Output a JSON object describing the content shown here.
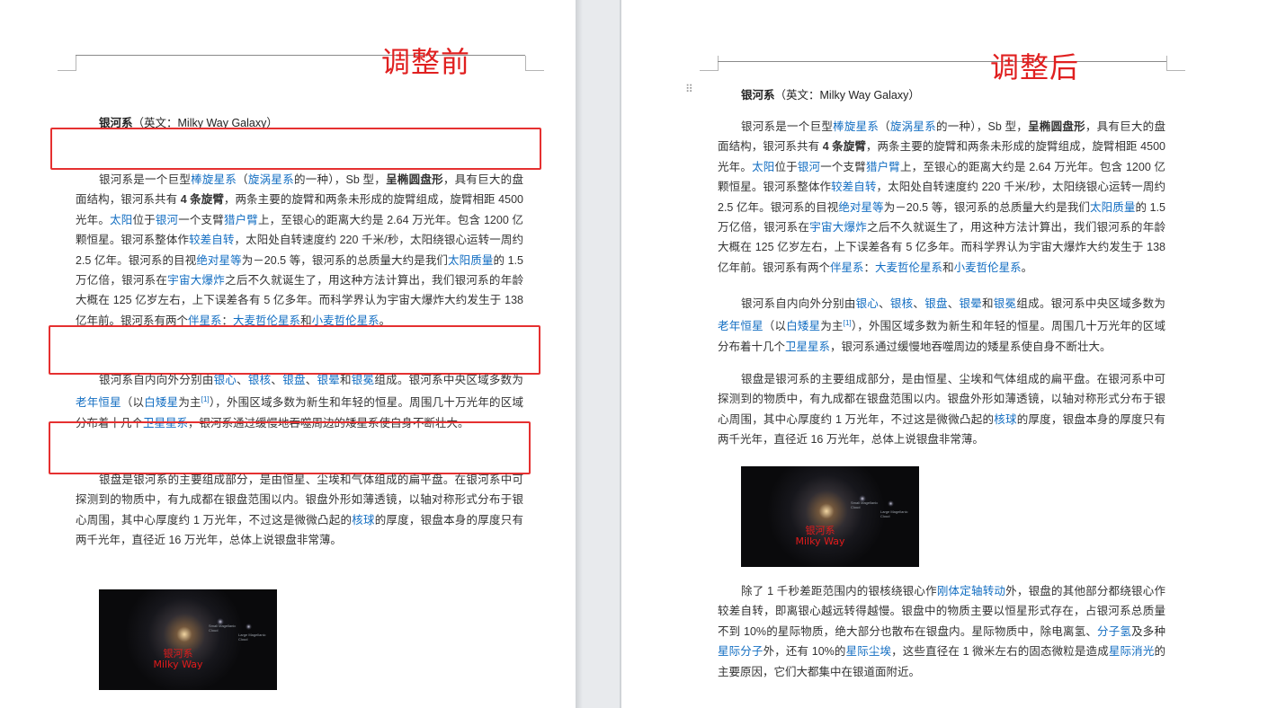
{
  "left": {
    "label": "调整前",
    "title_bold": "银河系",
    "title_rest": "（英文：Milky Way Galaxy）",
    "p1": [
      "银河系是一个巨型",
      {
        "link": "棒旋星系"
      },
      "（",
      {
        "link": "旋涡星系"
      },
      "的一种），Sb 型，",
      {
        "bold": "呈椭圆盘形"
      },
      "，具有巨大的盘面结构，银河系共有 ",
      {
        "bold": "4 条旋臂"
      },
      "，两条主要的旋臂和两条未形成的旋臂组成，旋臂相距 4500 光年。",
      {
        "link": "太阳"
      },
      "位于",
      {
        "link": "银河"
      },
      "一个支臂",
      {
        "link": "猎户臂"
      },
      "上，至银心的距离大约是 2.64 万光年。包含 1200 亿颗恒星。银河系整体作",
      {
        "link": "较差自转"
      },
      "，太阳处自转速度约 220 千米/秒，太阳绕银心运转一周约 2.5 亿年。银河系的目视",
      {
        "link": "绝对星等"
      },
      "为－20.5 等，银河系的总质量大约是我们",
      {
        "link": "太阳质量"
      },
      "的 1.5 万亿倍，银河系在",
      {
        "link": "宇宙大爆炸"
      },
      "之后不久就诞生了，用这种方法计算出，我们银河系的年龄大概在 125 亿岁左右，上下误差各有 5 亿多年。而科学界认为宇宙大爆炸大约发生于 138 亿年前。银河系有两个",
      {
        "link": "伴星系"
      },
      "：",
      {
        "link": "大麦哲伦星系"
      },
      "和",
      {
        "link": "小麦哲伦星系"
      },
      "。"
    ],
    "p2": [
      "银河系自内向外分别由",
      {
        "link": "银心"
      },
      "、",
      {
        "link": "银核"
      },
      "、",
      {
        "link": "银盘"
      },
      "、",
      {
        "link": "银晕"
      },
      "和",
      {
        "link": "银冕"
      },
      "组成。银河系中央区域多数为",
      {
        "link": "老年恒星"
      },
      "（以",
      {
        "link": "白矮星"
      },
      "为主",
      {
        "sup": "[1]"
      },
      "），外围区域多数为新生和年轻的恒星。周围几十万光年的区域分布着十几个",
      {
        "link": "卫星星系"
      },
      "，银河系通过缓慢地吞噬周边的矮星系使自身不断壮大。"
    ],
    "p3": [
      "银盘是银河系的主要组成部分，是由恒星、尘埃和气体组成的扁平盘。在银河系中可探测到的物质中，有九成都在银盘范围以内。银盘外形如薄透镜，以轴对称形式分布于银心周围，其中心厚度约 1 万光年，不过这是微微凸起的",
      {
        "link": "核球"
      },
      "的厚度，银盘本身的厚度只有两千光年，直径近 16 万光年，总体上说银盘非常薄。"
    ]
  },
  "right": {
    "label": "调整后",
    "p4": [
      "除了 1 千秒差距范围内的银核绕银心作",
      {
        "link": "刚体定轴转动"
      },
      "外，银盘的其他部分都绕银心作较差自转，即离银心越远转得越慢。银盘中的物质主要以恒星形式存在，占银河系总质量不到 10%的星际物质，绝大部分也散布在银盘内。星际物质中，除电离氢、",
      {
        "link": "分子氢"
      },
      "及多种",
      {
        "link": "星际分子"
      },
      "外，还有 10%的",
      {
        "link": "星际尘埃"
      },
      "，这些直径在 1 微米左右的固态微粒是造成",
      {
        "link": "星际消光"
      },
      "的主要原因，它们大都集中在银道面附近。"
    ]
  },
  "image": {
    "caption_cn": "银河系",
    "caption_en": "Milky Way",
    "tiny_label_1": "Small Magellanic Cloud",
    "tiny_label_2": "Large Magellanic Cloud"
  },
  "colors": {
    "link": "#136ec2",
    "annotation": "#e53030",
    "text": "#333333"
  },
  "icons": {
    "drag_handle": "⠿"
  }
}
